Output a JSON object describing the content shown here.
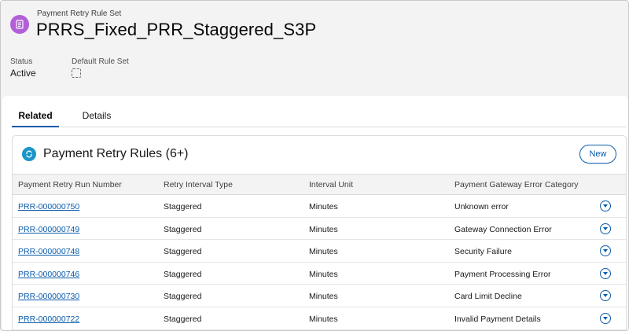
{
  "record": {
    "object_label": "Payment Retry Rule Set",
    "title": "PRRS_Fixed_PRR_Staggered_S3P",
    "icon": "rule-set-icon",
    "icon_color": "#b25fd8"
  },
  "highlights": {
    "status_label": "Status",
    "status_value": "Active",
    "default_label": "Default Rule Set",
    "default_checked": false
  },
  "tabs": [
    {
      "label": "Related",
      "active": true
    },
    {
      "label": "Details",
      "active": false
    }
  ],
  "related_list": {
    "title": "Payment Retry Rules (6+)",
    "icon": "payment-retry-icon",
    "icon_color": "#1b96c9",
    "new_label": "New",
    "columns": [
      "Payment Retry Run Number",
      "Retry Interval Type",
      "Interval Unit",
      "Payment Gateway Error Category"
    ],
    "rows": [
      {
        "number": "PRR-000000750",
        "type": "Staggered",
        "unit": "Minutes",
        "category": "Unknown error"
      },
      {
        "number": "PRR-000000749",
        "type": "Staggered",
        "unit": "Minutes",
        "category": "Gateway Connection Error"
      },
      {
        "number": "PRR-000000748",
        "type": "Staggered",
        "unit": "Minutes",
        "category": "Security Failure"
      },
      {
        "number": "PRR-000000746",
        "type": "Staggered",
        "unit": "Minutes",
        "category": "Payment Processing Error"
      },
      {
        "number": "PRR-000000730",
        "type": "Staggered",
        "unit": "Minutes",
        "category": "Card Limit Decline"
      },
      {
        "number": "PRR-000000722",
        "type": "Staggered",
        "unit": "Minutes",
        "category": "Invalid Payment Details"
      }
    ]
  },
  "colors": {
    "brand": "#0b5cab",
    "header_bg": "#f3f3f3"
  }
}
